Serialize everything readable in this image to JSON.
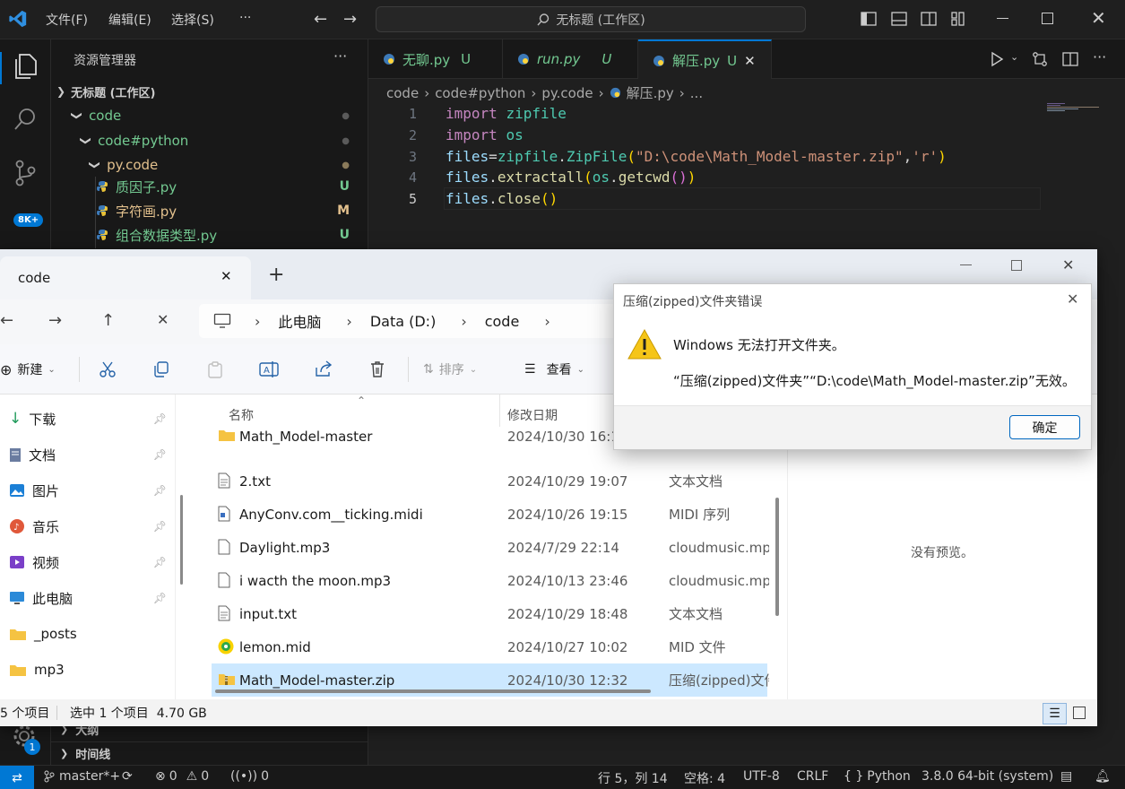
{
  "vscode": {
    "menu": [
      "文件(F)",
      "编辑(E)",
      "选择(S)",
      "···"
    ],
    "search_text": "无标题 (工作区)",
    "explorer_title": "资源管理器",
    "explorer_more": "···",
    "workspace": "无标题 (工作区)",
    "tree": [
      {
        "label": "code",
        "badge": "●"
      },
      {
        "label": "code#python",
        "badge": "●"
      },
      {
        "label": "py.code",
        "badge": "●"
      },
      {
        "label": "质因子.py",
        "badge": "U"
      },
      {
        "label": "字符画.py",
        "badge": "M"
      },
      {
        "label": "组合数据类型.py",
        "badge": "U"
      }
    ],
    "sidebar_bottom": [
      "大纲",
      "时间线"
    ],
    "scm_badge": "8K+",
    "settings_badge": "1",
    "tabs": [
      {
        "label": "无聊.py",
        "status": "U"
      },
      {
        "label": "run.py",
        "status": "U"
      },
      {
        "label": "解压.py",
        "status": "U"
      }
    ],
    "breadcrumb": [
      "code",
      "code#python",
      "py.code",
      "解压.py",
      "..."
    ],
    "line_numbers": [
      "1",
      "2",
      "3",
      "4",
      "5"
    ],
    "code": {
      "l1_kw": "import",
      "l1_mod": "zipfile",
      "l2_kw": "import",
      "l2_mod": "os",
      "l3_var": "files",
      "l3_eq": "=",
      "l3_mod": "zipfile",
      "l3_dot": ".",
      "l3_cls": "ZipFile",
      "l3_open": "(",
      "l3_s1": "\"D:\\code\\Math_Model-master.zip\"",
      "l3_comma": ",",
      "l3_s2": "'r'",
      "l3_close": ")",
      "l4_var": "files",
      "l4_dot": ".",
      "l4_fn": "extractall",
      "l4_open": "(",
      "l4_mod": "os",
      "l4_dot2": ".",
      "l4_fn2": "getcwd",
      "l4_in": "()",
      "l4_close": ")",
      "l5_var": "files",
      "l5_dot": ".",
      "l5_fn": "close",
      "l5_paren": "()"
    },
    "status": {
      "branch": "master*+",
      "errors": "0",
      "warnings": "0",
      "ports": "0",
      "position": "行 5，列 14",
      "spaces": "空格: 4",
      "encoding": "UTF-8",
      "eol": "CRLF",
      "language": "Python",
      "interpreter": "3.8.0 64-bit (system)"
    }
  },
  "explorer": {
    "tab_title": "code",
    "address": [
      "此电脑",
      "Data (D:)",
      "code"
    ],
    "commands": {
      "new": "新建",
      "sort": "排序",
      "view": "查看"
    },
    "nav_items": [
      {
        "label": "下载",
        "pinned": true
      },
      {
        "label": "文档",
        "pinned": true
      },
      {
        "label": "图片",
        "pinned": true
      },
      {
        "label": "音乐",
        "pinned": true
      },
      {
        "label": "视频",
        "pinned": true
      },
      {
        "label": "此电脑",
        "pinned": true
      },
      {
        "label": "_posts",
        "pinned": false
      },
      {
        "label": "mp3",
        "pinned": false
      }
    ],
    "columns": {
      "name": "名称",
      "date": "修改日期"
    },
    "files": [
      {
        "name": "Math_Model-master",
        "date": "2024/10/30 16:1",
        "type": "",
        "icon": "folder"
      },
      {
        "name": "2.txt",
        "date": "2024/10/29 19:07",
        "type": "文本文档",
        "icon": "text"
      },
      {
        "name": "AnyConv.com__ticking.midi",
        "date": "2024/10/26 19:15",
        "type": "MIDI 序列",
        "icon": "midi"
      },
      {
        "name": "Daylight.mp3",
        "date": "2024/7/29 22:14",
        "type": "cloudmusic.mp",
        "icon": "blank"
      },
      {
        "name": "i wacth the moon.mp3",
        "date": "2024/10/13 23:46",
        "type": "cloudmusic.mp",
        "icon": "blank"
      },
      {
        "name": "input.txt",
        "date": "2024/10/29 18:48",
        "type": "文本文档",
        "icon": "text"
      },
      {
        "name": "lemon.mid",
        "date": "2024/10/27 10:02",
        "type": "MID 文件",
        "icon": "music"
      },
      {
        "name": "Math_Model-master.zip",
        "date": "2024/10/30 12:32",
        "type": "压缩(zipped)文件",
        "icon": "zip",
        "selected": true
      }
    ],
    "preview_text": "没有预览。",
    "status_count": "5 个项目",
    "status_selection": "选中 1 个项目  4.70 GB"
  },
  "dialog": {
    "title": "压缩(zipped)文件夹错误",
    "message": "Windows 无法打开文件夹。",
    "detail": "“压缩(zipped)文件夹”“D:\\code\\Math_Model-master.zip”无效。",
    "ok": "确定"
  },
  "colors": {
    "vscode_bg": "#1f1f1f",
    "accent": "#0078d4",
    "untracked": "#73c991",
    "modified": "#e2c08d",
    "selection": "#cce8ff"
  }
}
